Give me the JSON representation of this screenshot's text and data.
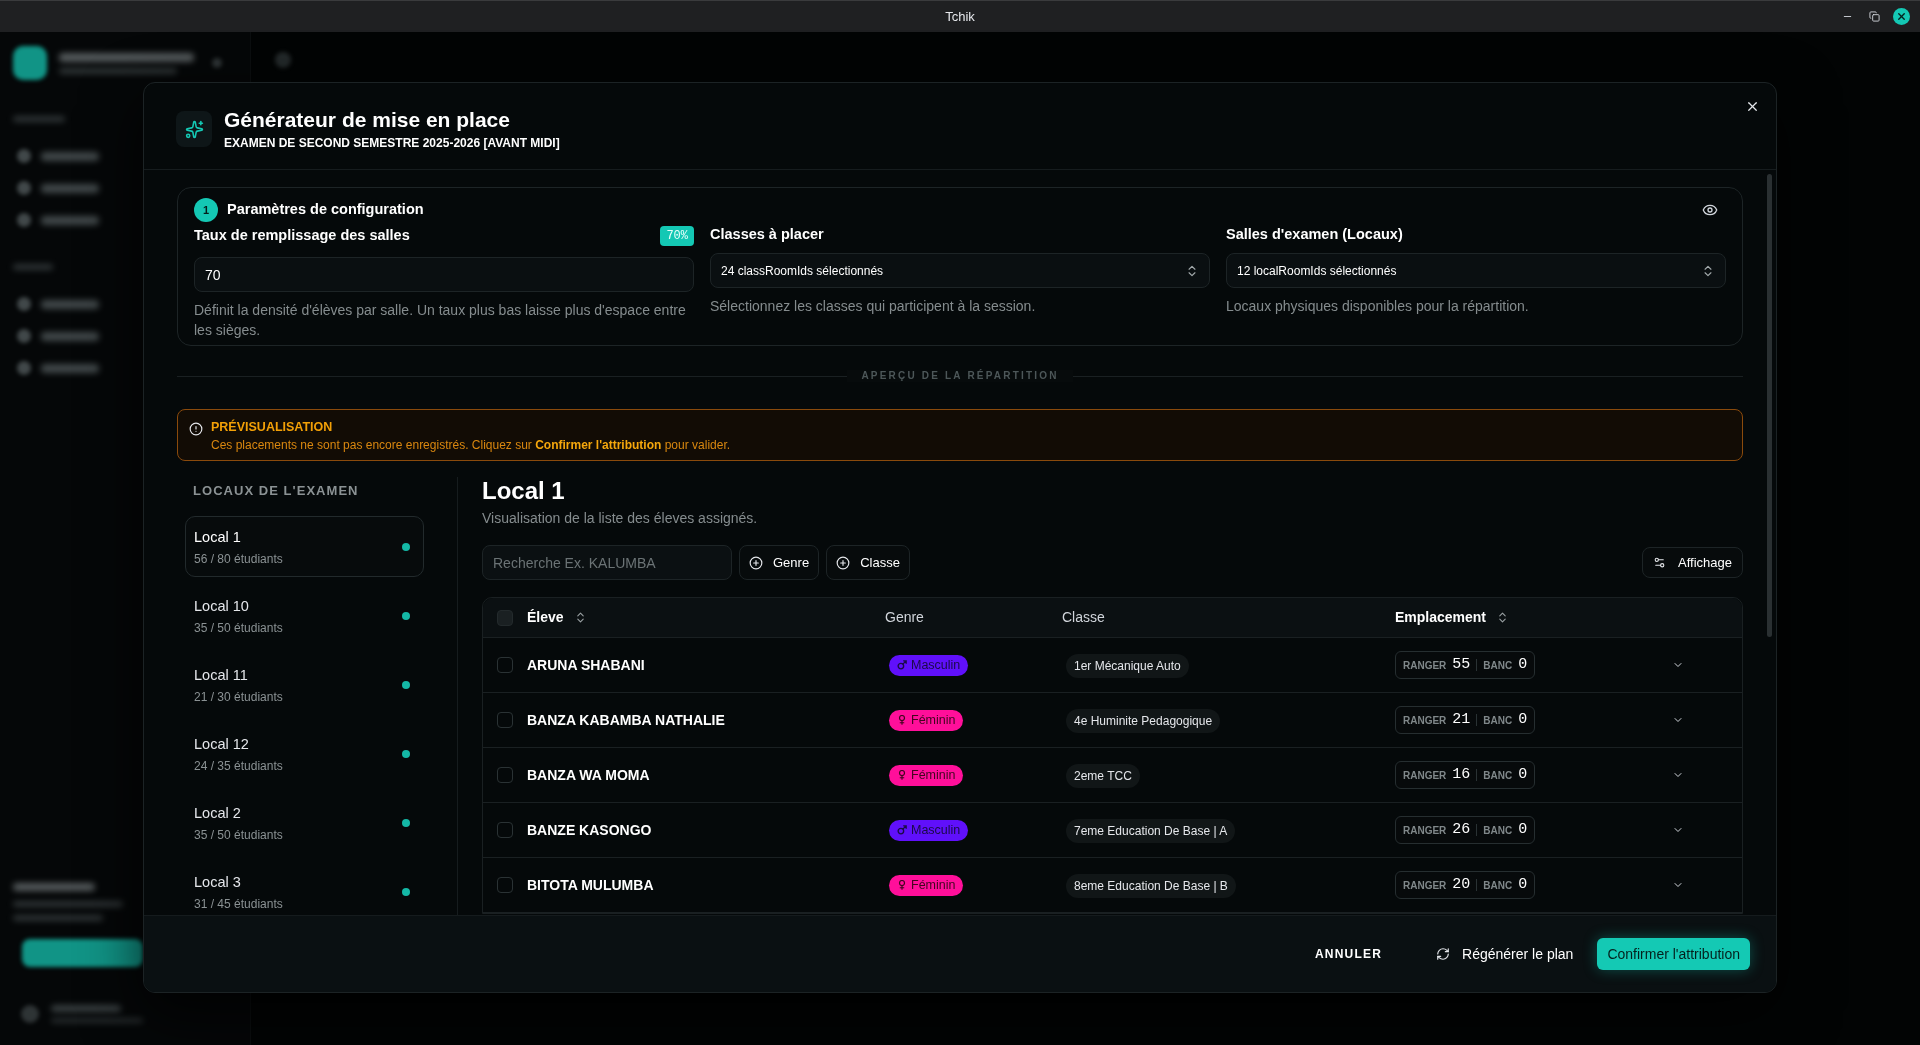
{
  "window": {
    "title": "Tchik"
  },
  "dialog": {
    "title": "Générateur de mise en place",
    "subtitle": "EXAMEN DE SECOND SEMESTRE 2025-2026 [AVANT MIDI]"
  },
  "config": {
    "step": "1",
    "title": "Paramètres de configuration",
    "fields": [
      {
        "kind": "number",
        "label": "Taux de remplissage des salles",
        "badge": "70%",
        "value": "70",
        "help": "Définit la densité d'élèves par salle. Un taux plus bas laisse plus d'espace entre les sièges."
      },
      {
        "kind": "select",
        "label": "Classes à placer",
        "value": "24 classRoomIds sélectionnés",
        "help": "Sélectionnez les classes qui participent à la session."
      },
      {
        "kind": "select",
        "label": "Salles d'examen (Locaux)",
        "value": "12 localRoomIds sélectionnés",
        "help": "Locaux physiques disponibles pour la répartition."
      }
    ]
  },
  "section_divider": "APERÇU DE LA RÉPARTITION",
  "notice": {
    "title": "PRÉVISUALISATION",
    "message": "Ces placements ne sont pas encore enregistrés. Cliquez sur **Confirmer l'attribution** pour valider."
  },
  "rooms": {
    "heading": "LOCAUX DE L'EXAMEN",
    "items": [
      {
        "name": "Local 1",
        "count": "56 / 80 étudiants",
        "selected": true
      },
      {
        "name": "Local 10",
        "count": "35 / 50 étudiants",
        "selected": false
      },
      {
        "name": "Local 11",
        "count": "21 / 30 étudiants",
        "selected": false
      },
      {
        "name": "Local 12",
        "count": "24 / 35 étudiants",
        "selected": false
      },
      {
        "name": "Local 2",
        "count": "35 / 50 étudiants",
        "selected": false
      },
      {
        "name": "Local 3",
        "count": "31 / 45 étudiants",
        "selected": false
      }
    ]
  },
  "detail": {
    "title": "Local 1",
    "subtitle": "Visualisation de la liste des éleves assignés.",
    "search": {
      "placeholder": "Recherche Ex. KALUMBA"
    },
    "filters": [
      "Genre",
      "Classe"
    ],
    "view_button": "Affichage"
  },
  "table": {
    "select_all": {
      "checked": false
    },
    "columns": [
      {
        "label": "Éleve",
        "sortable": true
      },
      {
        "label": "Genre",
        "sortable": false
      },
      {
        "label": "Classe",
        "sortable": false
      },
      {
        "label": "Emplacement",
        "sortable": true
      }
    ],
    "rows": [
      {
        "checked": false,
        "name": "ARUNA SHABANI",
        "gender": {
          "kind": "male",
          "label": "Masculin"
        },
        "class": "1er Mécanique Auto",
        "place": {
          "row_label": "RANGER",
          "row": "55",
          "bench_label": "BANC",
          "bench": "0"
        }
      },
      {
        "checked": false,
        "name": "BANZA KABAMBA NATHALIE",
        "gender": {
          "kind": "female",
          "label": "Féminin"
        },
        "class": "4e Huminite Pedagogique",
        "place": {
          "row_label": "RANGER",
          "row": "21",
          "bench_label": "BANC",
          "bench": "0"
        }
      },
      {
        "checked": false,
        "name": "BANZA WA MOMA",
        "gender": {
          "kind": "female",
          "label": "Féminin"
        },
        "class": "2eme TCC",
        "place": {
          "row_label": "RANGER",
          "row": "16",
          "bench_label": "BANC",
          "bench": "0"
        }
      },
      {
        "checked": false,
        "name": "BANZE KASONGO",
        "gender": {
          "kind": "male",
          "label": "Masculin"
        },
        "class": "7eme Education De Base | A",
        "place": {
          "row_label": "RANGER",
          "row": "26",
          "bench_label": "BANC",
          "bench": "0"
        }
      },
      {
        "checked": false,
        "name": "BITOTA MULUMBA",
        "gender": {
          "kind": "female",
          "label": "Féminin"
        },
        "class": "8eme Education De Base | B",
        "place": {
          "row_label": "RANGER",
          "row": "20",
          "bench_label": "BANC",
          "bench": "0"
        }
      }
    ]
  },
  "footer": {
    "cancel": "ANNULER",
    "regenerate": "Régénérer le plan",
    "confirm": "Confirmer l'attribution"
  }
}
